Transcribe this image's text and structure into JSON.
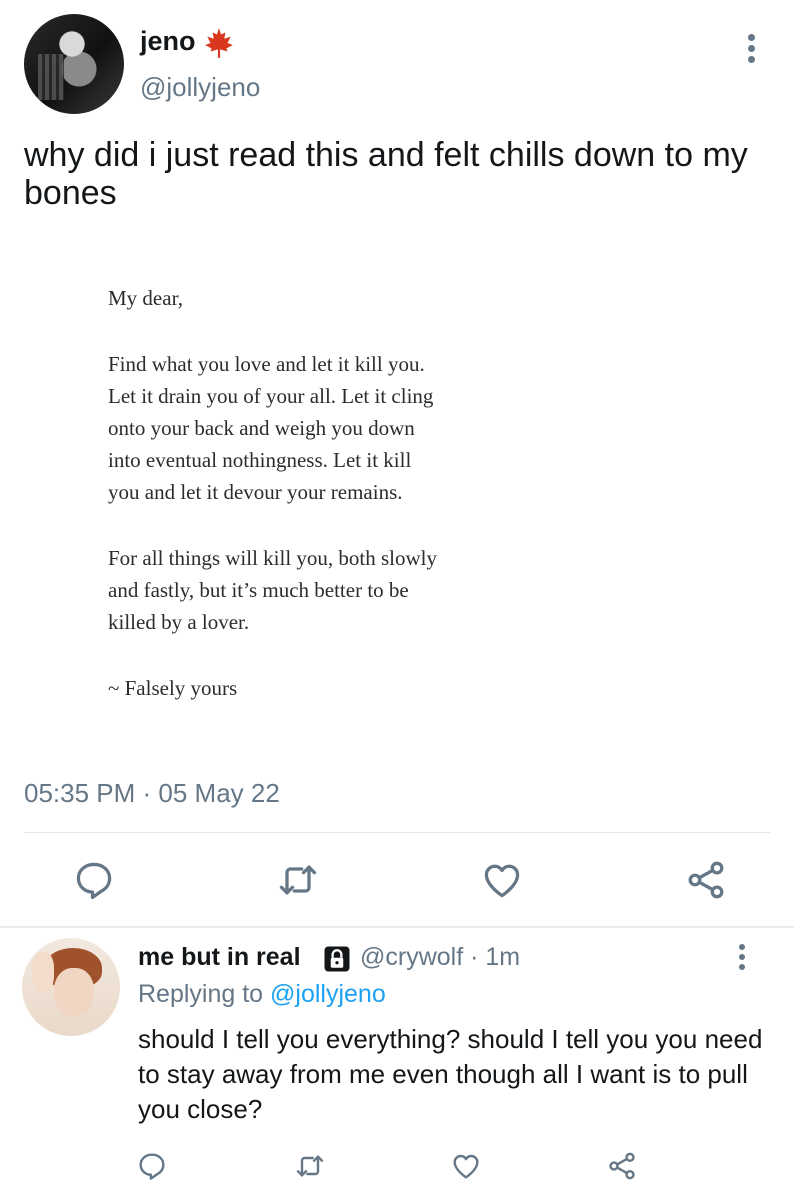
{
  "tweet": {
    "author_name": "jeno",
    "author_handle": "@jollyjeno",
    "text": "why did i just read this and felt chills down to my bones",
    "image_letter": {
      "greeting": "My dear,",
      "paragraph1_lines": [
        "Find what you love and let it kill you.",
        "Let it drain you of your all. Let it cling",
        "onto your back and weigh you down",
        "into eventual nothingness. Let it kill",
        "you and let it devour your remains."
      ],
      "paragraph2_lines": [
        "For all things will kill you, both slowly",
        "and fastly, but it’s much better to be",
        "killed by a lover."
      ],
      "signoff": "~ Falsely yours"
    },
    "timestamp": "05:35 PM · 05 May 22",
    "actions": [
      "reply-icon",
      "retweet-icon",
      "like-icon",
      "share-icon"
    ],
    "accent_color": "#1da1f2",
    "icon_color": "#657786"
  },
  "reply": {
    "author_name": "me but in real",
    "author_handle": "@crywolf",
    "time": "· 1m",
    "replying_prefix": "Replying to",
    "replying_to": "@jollyjeno",
    "text": "should I tell you everything? should I tell you you need to stay away from me even though all I want is to pull you close?",
    "actions": [
      "reply-icon",
      "retweet-icon",
      "like-icon",
      "share-icon"
    ]
  }
}
